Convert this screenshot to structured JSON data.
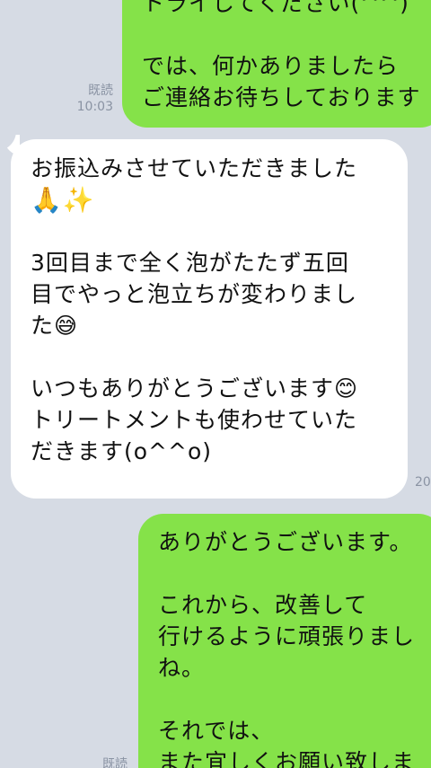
{
  "messages": [
    {
      "type": "outgoing",
      "lines": [
        "トライしてください(^^)",
        "",
        "では、何かありましたら",
        "ご連絡お待ちしております"
      ],
      "read_label": "既読",
      "time": "10:03"
    },
    {
      "type": "incoming",
      "lines": [
        "お振込みさせていただきました",
        "🙏✨",
        "",
        "3回目まで全く泡がたたず五回",
        "目でやっと泡立ちが変わりまし",
        "た😅",
        "",
        "いつもありがとうございます😊",
        "トリートメントも使わせていた",
        "だきます(o^^o)"
      ],
      "time_partial": "20"
    },
    {
      "type": "outgoing",
      "lines": [
        "ありがとうございます。",
        "",
        "これから、改善して",
        "行けるように頑張りまし",
        "ね。",
        "",
        "それでは、",
        "また宜しくお願い致しま"
      ],
      "read_label": "既読"
    }
  ],
  "colors": {
    "background": "#d6dbe4",
    "outgoing_bubble": "#85e249",
    "incoming_bubble": "#ffffff",
    "meta_text": "#8a93a3"
  }
}
